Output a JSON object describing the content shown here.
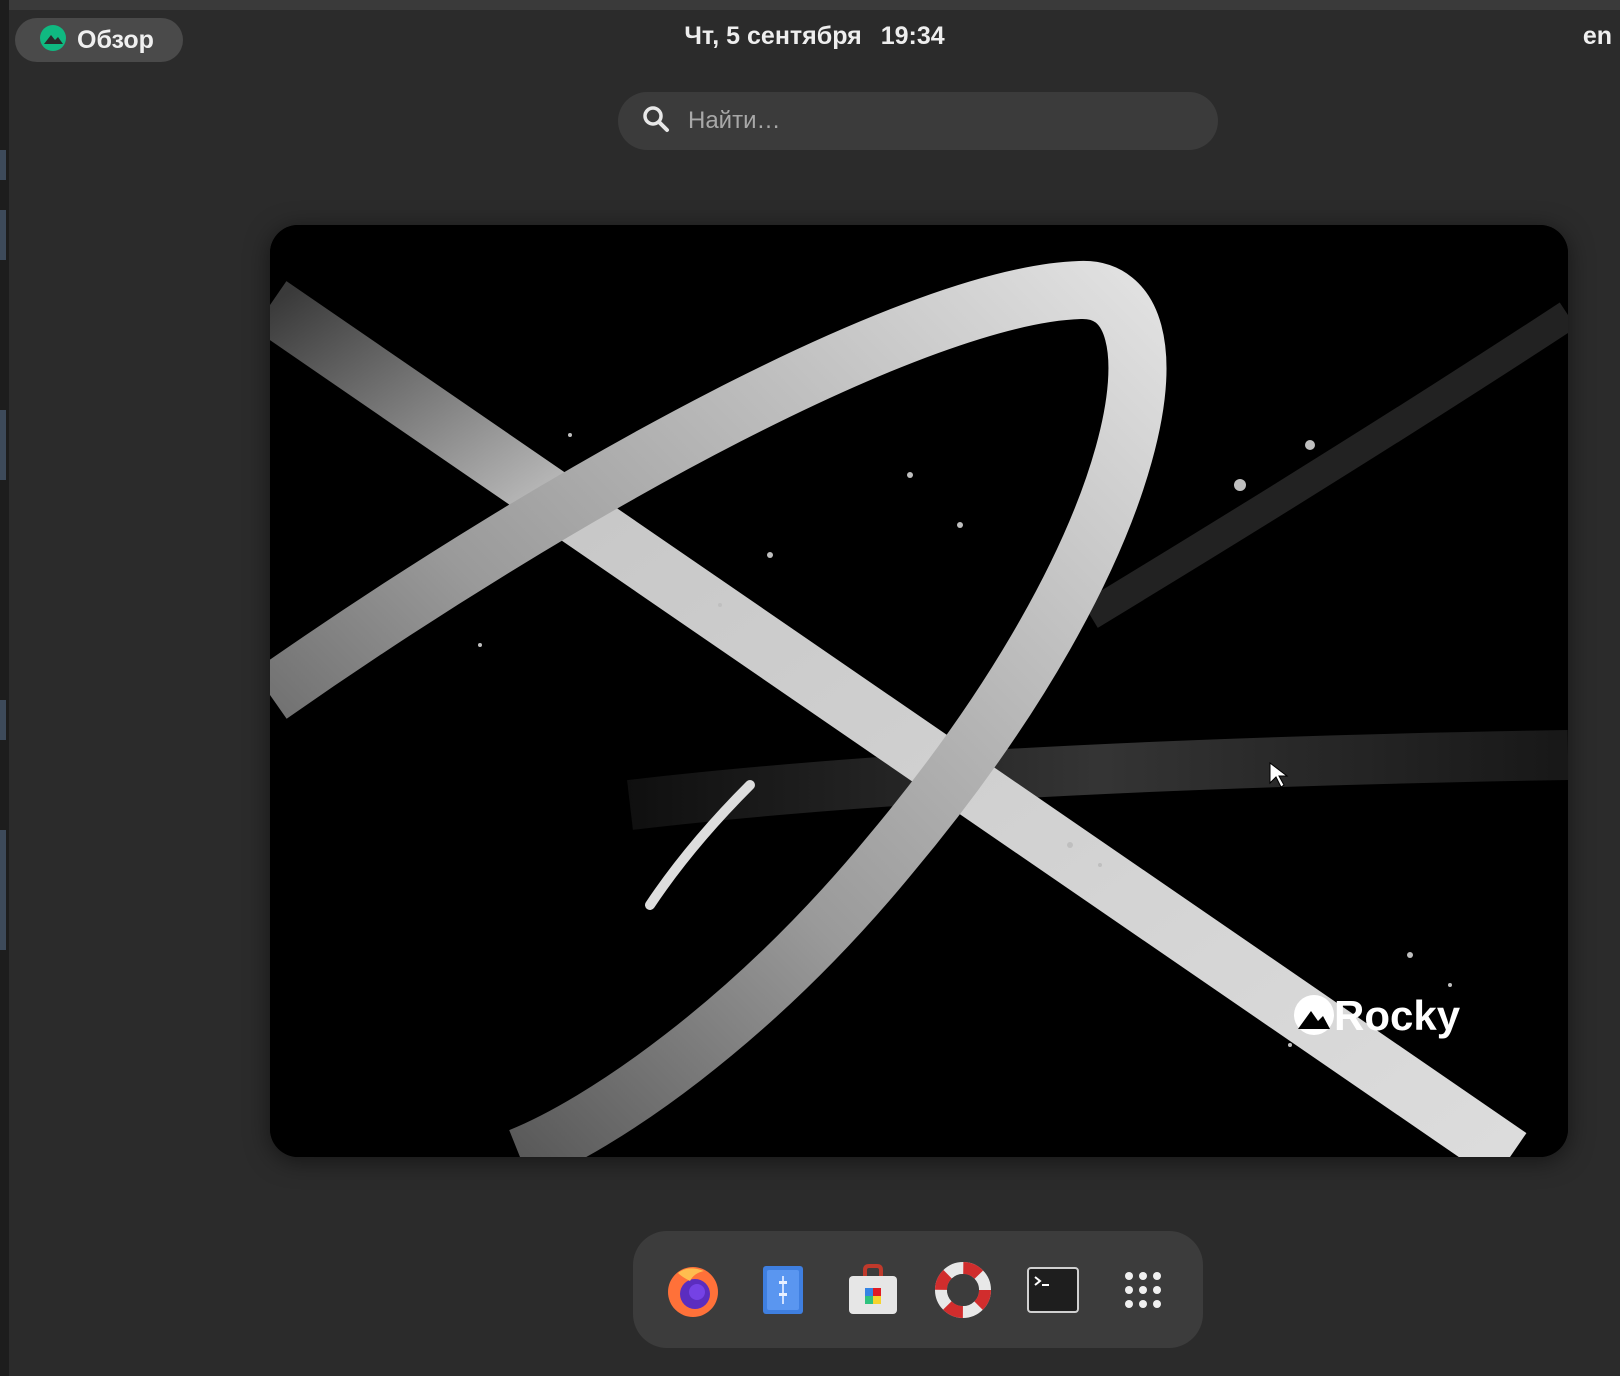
{
  "topbar": {
    "activities_label": "Обзор",
    "clock_date": "Чт, 5 сентября",
    "clock_time": "19:34",
    "keyboard_layout": "en"
  },
  "search": {
    "placeholder": "Найти…"
  },
  "workspace": {
    "wallpaper_logo_text": "Rocky"
  },
  "dash": {
    "apps": [
      {
        "name": "Firefox",
        "icon": "firefox-icon"
      },
      {
        "name": "Files",
        "icon": "files-icon"
      },
      {
        "name": "Software",
        "icon": "software-icon"
      },
      {
        "name": "Help",
        "icon": "help-icon"
      },
      {
        "name": "Terminal",
        "icon": "terminal-icon"
      },
      {
        "name": "Show Applications",
        "icon": "app-grid-icon"
      }
    ]
  },
  "colors": {
    "background": "#2b2b2b",
    "panel_pill": "#4a4a4a",
    "search_bg": "#3b3b3b",
    "dash_bg": "#3c3c3c",
    "rocky_green": "#10b981"
  }
}
